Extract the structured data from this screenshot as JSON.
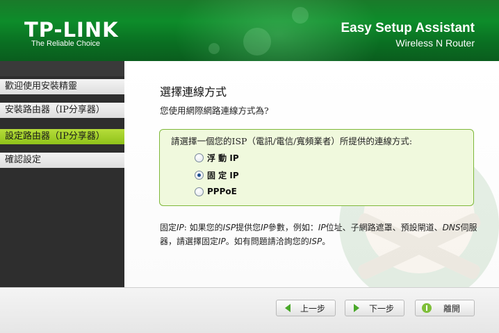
{
  "header": {
    "logo": "TP-LINK",
    "tagline": "The Reliable Choice",
    "title": "Easy Setup Assistant",
    "subtitle": "Wireless N Router"
  },
  "sidebar": {
    "items": [
      {
        "label": "歡迎使用安裝精靈",
        "active": false
      },
      {
        "label": "安裝路由器（IP分享器）",
        "active": false
      },
      {
        "label": "設定路由器（IP分享器）",
        "active": true
      },
      {
        "label": "確認設定",
        "active": false
      }
    ]
  },
  "main": {
    "title": "選擇連線方式",
    "question": "您使用網際網路連線方式為?",
    "prompt": "請選擇一個您的ISP（電訊/電信/寬頻業者）所提供的連線方式:",
    "options": [
      {
        "label": "浮 動 IP",
        "checked": false
      },
      {
        "label": "固 定 IP",
        "checked": true
      },
      {
        "label": "PPPoE",
        "checked": false
      }
    ],
    "help": {
      "t1": "固定",
      "i1": "IP",
      "t2": ": 如果您的",
      "i2": "ISP",
      "t3": "提供您",
      "i3": "IP",
      "t4": "參數，例如：",
      "i4": "IP",
      "t5": "位址、子網路遮罩、預設閘道、",
      "i5": "DNS",
      "t6": "伺服器，請選擇固定",
      "i6": "IP",
      "t7": "。如有問題請洽詢您的",
      "i7": "ISP",
      "t8": "。"
    }
  },
  "footer": {
    "back_label": "上一步",
    "next_label": "下一步",
    "exit_label": "離開"
  },
  "colors": {
    "header_green": "#0d8c2a",
    "active_item": "#9fcd25",
    "box_border": "#7fb83a",
    "box_bg": "#f0f9dd"
  }
}
